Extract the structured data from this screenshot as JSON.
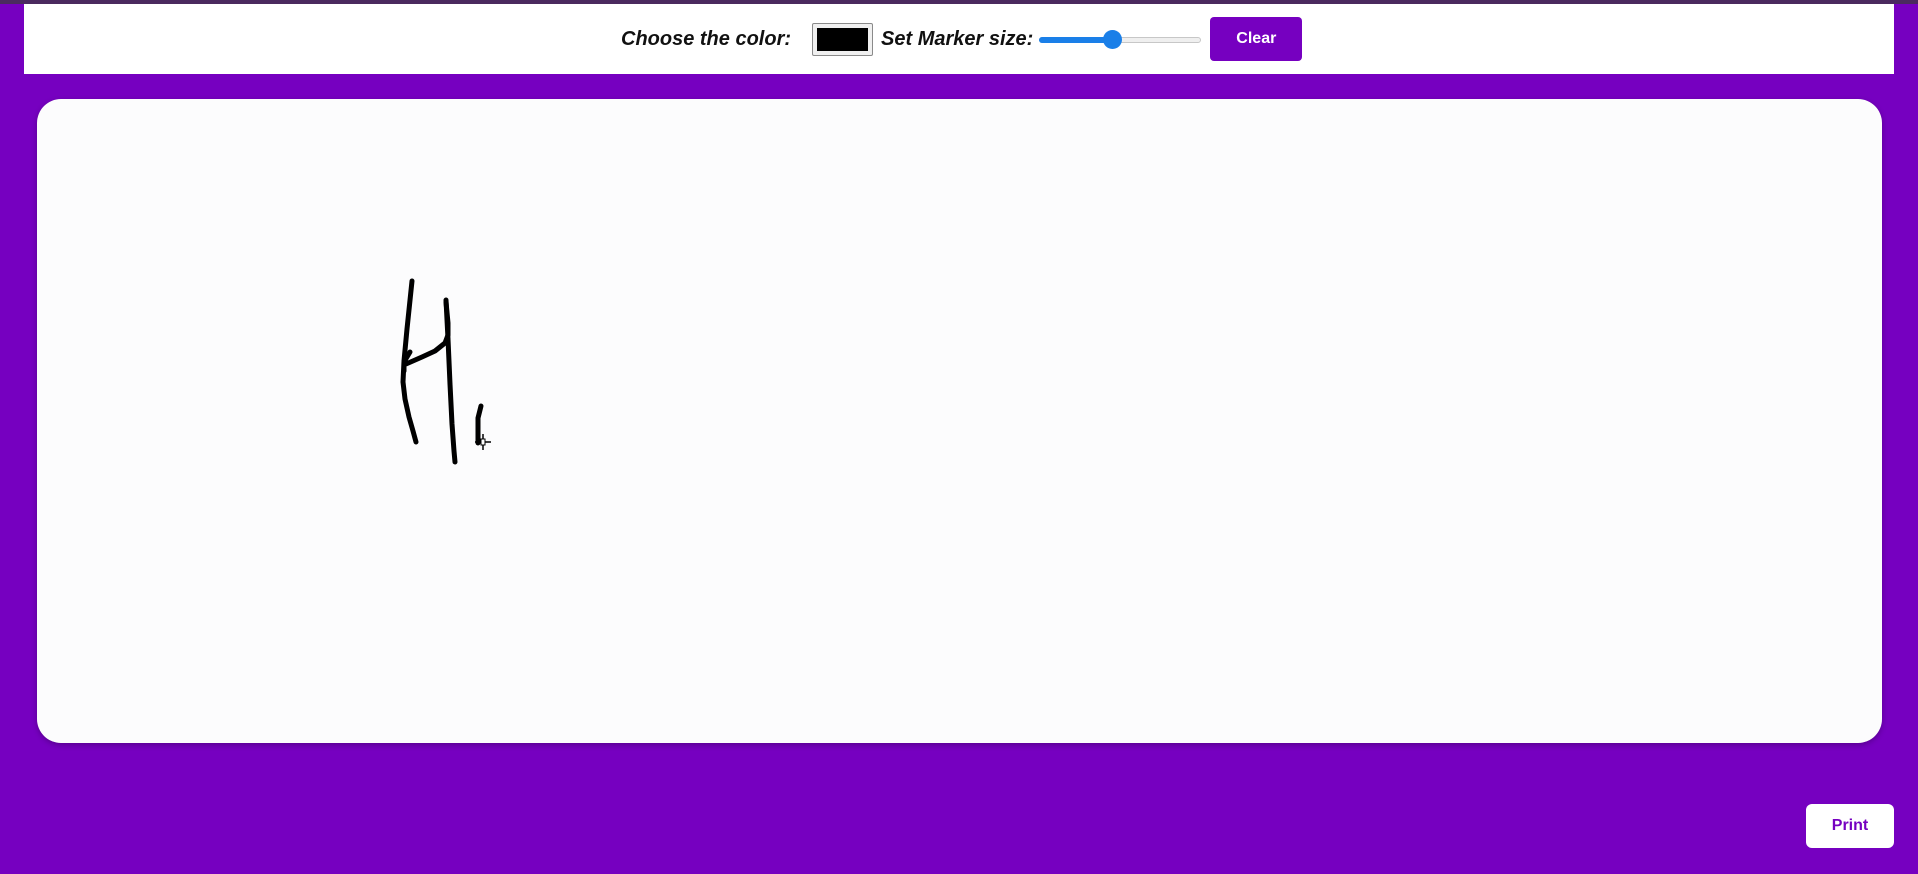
{
  "toolbar": {
    "color_label": "Choose the color:",
    "selected_color": "#000000",
    "size_label": "Set Marker size:",
    "marker_size_fraction": 0.45,
    "clear_label": "Clear"
  },
  "canvas": {
    "stroke_color": "#000000",
    "cursor_icon": "crosshair-cursor-icon"
  },
  "footer": {
    "print_label": "Print"
  },
  "colors": {
    "page_background": "#7600c0",
    "accent": "#7600c0",
    "slider_fill": "#1a7fe8",
    "canvas_background": "#fcfcfd"
  }
}
